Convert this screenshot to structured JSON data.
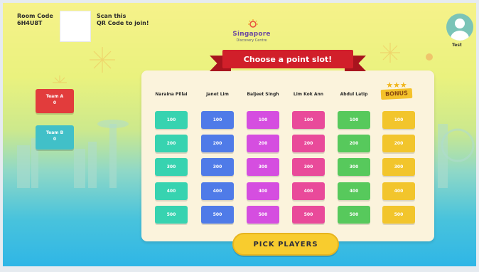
{
  "room": {
    "code_label": "Room Code",
    "code_value": "6H4U8T",
    "scan_line1": "Scan this",
    "scan_line2": "QR Code to join!"
  },
  "logo": {
    "brand": "Singapore",
    "sub": "Discovery Centre"
  },
  "user": {
    "name": "Test"
  },
  "teams": [
    {
      "name": "Team A",
      "score": "0",
      "color": "#e23c3c"
    },
    {
      "name": "Team B",
      "score": "0",
      "color": "#41c0c8"
    }
  ],
  "board": {
    "title": "Choose a point slot!",
    "columns": [
      {
        "header": "Naraina Pillai",
        "color": "#37d3b0"
      },
      {
        "header": "Janet Lim",
        "color": "#4f7be8"
      },
      {
        "header": "Baljeet Singh",
        "color": "#d54ee0"
      },
      {
        "header": "Lim Kok Ann",
        "color": "#e94a9a"
      },
      {
        "header": "Abdul Latip",
        "color": "#57c95c"
      },
      {
        "header": "BONUS",
        "color": "#f2c52c"
      }
    ],
    "points": [
      "100",
      "200",
      "300",
      "400",
      "500"
    ]
  },
  "actions": {
    "pick_players": "PICK PLAYERS"
  }
}
